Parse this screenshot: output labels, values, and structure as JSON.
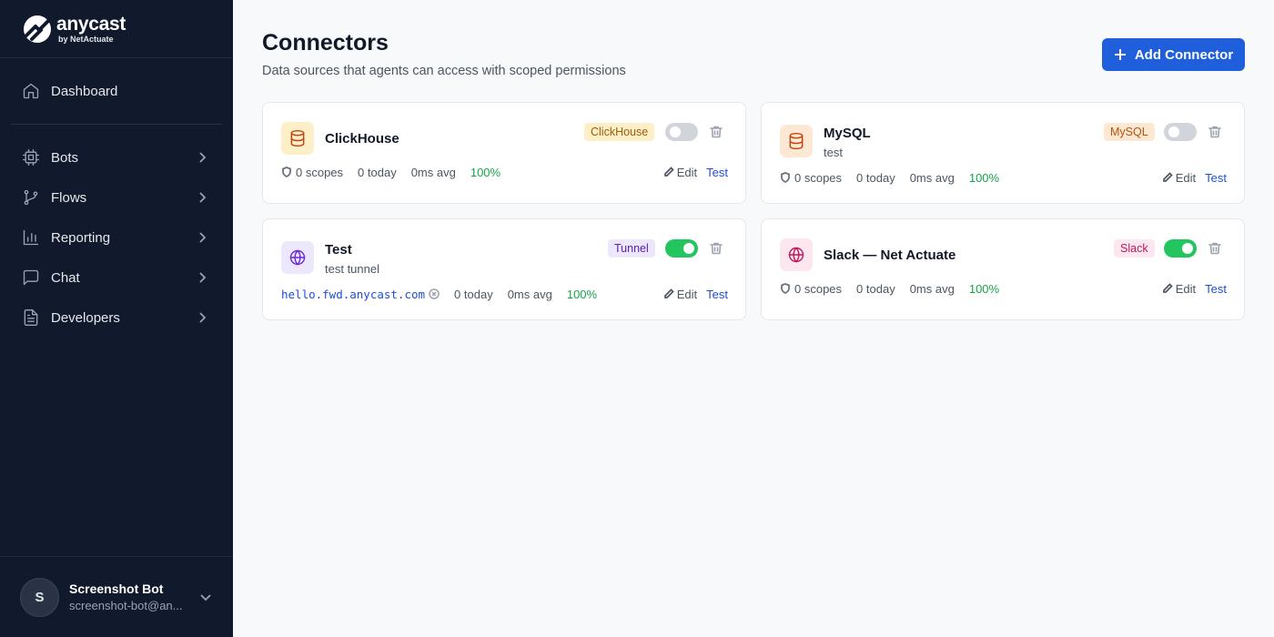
{
  "sidebar": {
    "brand": {
      "name": "anycast",
      "sub": "by NetActuate"
    },
    "nav": [
      {
        "label": "Dashboard",
        "icon": "home-icon"
      },
      {
        "label": "Bots",
        "icon": "cpu-icon"
      },
      {
        "label": "Flows",
        "icon": "git-branch-icon"
      },
      {
        "label": "Reporting",
        "icon": "bar-chart-icon"
      },
      {
        "label": "Chat",
        "icon": "message-square-icon"
      },
      {
        "label": "Developers",
        "icon": "file-text-icon"
      }
    ],
    "user": {
      "initial": "S",
      "name": "Screenshot Bot",
      "email": "screenshot-bot@an..."
    }
  },
  "page": {
    "title": "Connectors",
    "subtitle": "Data sources that agents can access with scoped permissions",
    "add_button": "Add Connector"
  },
  "connectors": [
    {
      "name": "ClickHouse",
      "description": "",
      "badge": "ClickHouse",
      "enabled": false,
      "icon": "database-icon",
      "scopes": "0 scopes",
      "today": "0 today",
      "avg": "0ms avg",
      "success": "100%",
      "edit": "Edit",
      "test": "Test",
      "colors": {
        "icon_bg": "#fdefc8",
        "icon_fg": "#c2410c",
        "badge_bg": "#fdefc8",
        "badge_fg": "#a15c07"
      }
    },
    {
      "name": "MySQL",
      "description": "test",
      "badge": "MySQL",
      "enabled": false,
      "icon": "database-icon",
      "scopes": "0 scopes",
      "today": "0 today",
      "avg": "0ms avg",
      "success": "100%",
      "edit": "Edit",
      "test": "Test",
      "colors": {
        "icon_bg": "#fde8d4",
        "icon_fg": "#c2410c",
        "badge_bg": "#fde8d4",
        "badge_fg": "#b45309"
      }
    },
    {
      "name": "Test",
      "description": "test tunnel",
      "badge": "Tunnel",
      "enabled": true,
      "icon": "globe-icon",
      "url": "hello.fwd.anycast.com",
      "today": "0 today",
      "avg": "0ms avg",
      "success": "100%",
      "edit": "Edit",
      "test": "Test",
      "colors": {
        "icon_bg": "#ede7fb",
        "icon_fg": "#6d28d9",
        "badge_bg": "#ede7fb",
        "badge_fg": "#5b21b6"
      }
    },
    {
      "name": "Slack — Net Actuate",
      "description": "",
      "badge": "Slack",
      "enabled": true,
      "icon": "globe-icon",
      "scopes": "0 scopes",
      "today": "0 today",
      "avg": "0ms avg",
      "success": "100%",
      "edit": "Edit",
      "test": "Test",
      "colors": {
        "icon_bg": "#fce7f0",
        "icon_fg": "#be185d",
        "badge_bg": "#fce7f0",
        "badge_fg": "#be185d"
      }
    }
  ],
  "colors": {
    "sidebar_bg": "#111a2c",
    "accent": "#1f5fdc",
    "success": "#16a34a",
    "toggle_on": "#22c55e"
  }
}
